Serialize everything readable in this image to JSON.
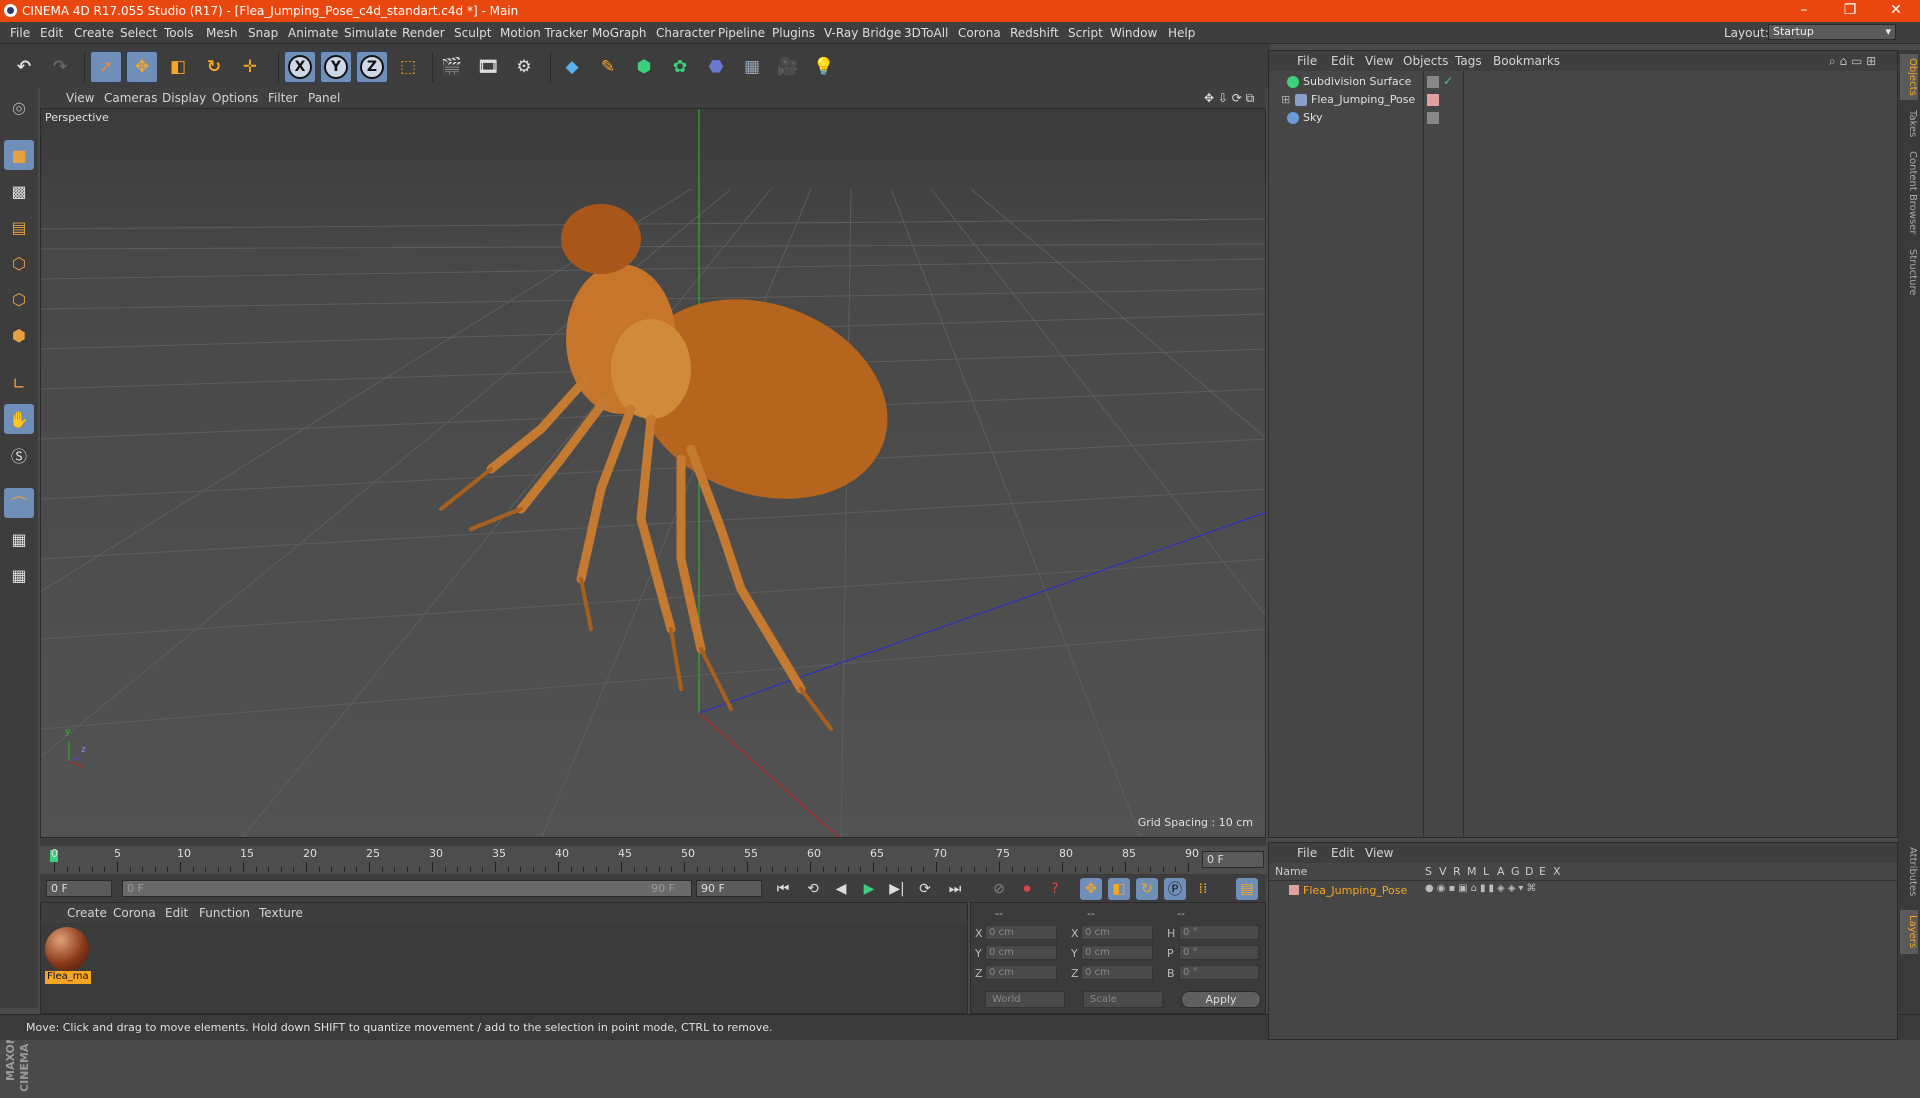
{
  "window": {
    "title": "CINEMA 4D R17.055 Studio (R17) - [Flea_Jumping_Pose_c4d_standart.c4d *] - Main",
    "controls": [
      "–",
      "❐",
      "✕"
    ]
  },
  "menu": [
    "File",
    "Edit",
    "Create",
    "Select",
    "Tools",
    "Mesh",
    "Snap",
    "Animate",
    "Simulate",
    "Render",
    "Sculpt",
    "Motion Tracker",
    "MoGraph",
    "Character",
    "Pipeline",
    "Plugins",
    "V-Ray Bridge",
    "3DToAll",
    "Corona",
    "Redshift",
    "Script",
    "Window",
    "Help"
  ],
  "layout": {
    "label": "Layout:",
    "value": "Startup"
  },
  "toolbar": {
    "axis_x": "X",
    "axis_y": "Y",
    "axis_z": "Z"
  },
  "viewport": {
    "menu": [
      "View",
      "Cameras",
      "Display",
      "Options",
      "Filter",
      "Panel"
    ],
    "label": "Perspective",
    "grid_spacing": "Grid Spacing : 10 cm",
    "axis_labels": {
      "y": "y",
      "z": "z"
    }
  },
  "timeline": {
    "ticks": [
      "0",
      "5",
      "10",
      "15",
      "20",
      "25",
      "30",
      "35",
      "40",
      "45",
      "50",
      "55",
      "60",
      "65",
      "70",
      "75",
      "80",
      "85",
      "90"
    ],
    "current_frame": "0 F",
    "start": "0 F",
    "range_start": "0 F",
    "range_end": "90 F",
    "end": "90 F"
  },
  "material_manager": {
    "menu": [
      "Create",
      "Corona",
      "Edit",
      "Function",
      "Texture"
    ],
    "materials": [
      {
        "name": "Flea_ma"
      }
    ]
  },
  "coordinates": {
    "headers": [
      "--",
      "--",
      "--"
    ],
    "rows": [
      {
        "a": "X",
        "av": "0 cm",
        "b": "X",
        "bv": "0 cm",
        "c": "H",
        "cv": "0 °"
      },
      {
        "a": "Y",
        "av": "0 cm",
        "b": "Y",
        "bv": "0 cm",
        "c": "P",
        "cv": "0 °"
      },
      {
        "a": "Z",
        "av": "0 cm",
        "b": "Z",
        "bv": "0 cm",
        "c": "B",
        "cv": "0 °"
      }
    ],
    "mode1": "World",
    "mode2": "Scale",
    "apply": "Apply"
  },
  "status": "Move: Click and drag to move elements. Hold down SHIFT to quantize movement / add to the selection in point mode, CTRL to remove.",
  "object_manager": {
    "menu": [
      "File",
      "Edit",
      "View",
      "Objects",
      "Tags",
      "Bookmarks"
    ],
    "objects": [
      {
        "name": "Subdivision Surface"
      },
      {
        "name": "Flea_Jumping_Pose"
      },
      {
        "name": "Sky"
      }
    ]
  },
  "layer_manager": {
    "menu": [
      "File",
      "Edit",
      "View"
    ],
    "columns": [
      "Name",
      "S",
      "V",
      "R",
      "M",
      "L",
      "A",
      "G",
      "D",
      "E",
      "X"
    ],
    "layers": [
      {
        "name": "Flea_Jumping_Pose"
      }
    ]
  },
  "side_tabs": [
    "Objects",
    "Takes",
    "Content Browser",
    "Structure",
    "Attributes",
    "Layers"
  ],
  "colors": {
    "accent": "#e8470f",
    "selection": "#6f8fb8",
    "highlight": "#f6a623"
  }
}
